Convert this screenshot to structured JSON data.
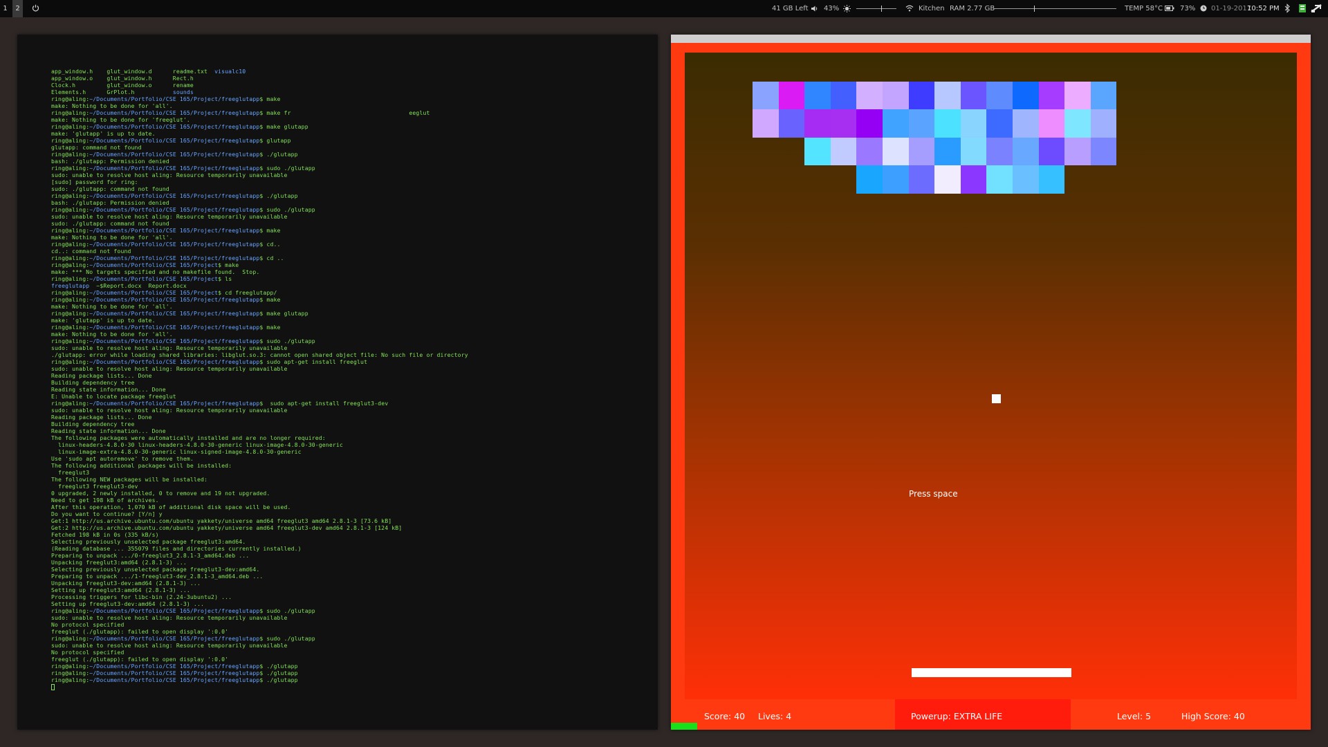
{
  "topbar": {
    "workspaces": [
      "1",
      "2"
    ],
    "active_workspace": "2",
    "disk": "41 GB Left",
    "volume": "43%",
    "volume_level": 0.43,
    "brightness_level": 0.62,
    "wifi": "Kitchen",
    "ram": "RAM 2.77 GB",
    "ram_level": 0.33,
    "temp": "TEMP 58°C",
    "battery": "73%",
    "date": "01-19-2017",
    "time": "10:52 PM"
  },
  "terminal": {
    "lines": [
      {
        "c": "app_window.h    glut_window.d      readme.txt  ",
        "b": "visualc10"
      },
      {
        "c": "app_window.o    glut_window.h      Rect.h"
      },
      {
        "c": "Clock.h         glut_window.o      rename"
      },
      {
        "c": "Elements.h      GrPlot.h           ",
        "b": "sounds"
      },
      {
        "p": "ring@aling:",
        "path": "~/Documents/Portfolio/CSE 165/Project/freeglutapp",
        "c": "$ make"
      },
      {
        "c": "make: Nothing to be done for 'all'."
      },
      {
        "p": "ring@aling:",
        "path": "~/Documents/Portfolio/CSE 165/Project/freeglutapp",
        "c": "$ make fr                                  eeglut"
      },
      {
        "c": "make: Nothing to be done for 'freeglut'."
      },
      {
        "p": "ring@aling:",
        "path": "~/Documents/Portfolio/CSE 165/Project/freeglutapp",
        "c": "$ make glutapp"
      },
      {
        "c": "make: 'glutapp' is up to date."
      },
      {
        "p": "ring@aling:",
        "path": "~/Documents/Portfolio/CSE 165/Project/freeglutapp",
        "c": "$ glutapp"
      },
      {
        "c": "glutapp: command not found"
      },
      {
        "p": "ring@aling:",
        "path": "~/Documents/Portfolio/CSE 165/Project/freeglutapp",
        "c": "$ ./glutapp"
      },
      {
        "c": "bash: ./glutapp: Permission denied"
      },
      {
        "p": "ring@aling:",
        "path": "~/Documents/Portfolio/CSE 165/Project/freeglutapp",
        "c": "$ sudo ./glutapp"
      },
      {
        "c": "sudo: unable to resolve host aling: Resource temporarily unavailable"
      },
      {
        "c": "[sudo] password for ring:"
      },
      {
        "c": "sudo: ./glutapp: command not found"
      },
      {
        "p": "ring@aling:",
        "path": "~/Documents/Portfolio/CSE 165/Project/freeglutapp",
        "c": "$ ./glutapp"
      },
      {
        "c": "bash: ./glutapp: Permission denied"
      },
      {
        "p": "ring@aling:",
        "path": "~/Documents/Portfolio/CSE 165/Project/freeglutapp",
        "c": "$ sudo ./glutapp"
      },
      {
        "c": "sudo: unable to resolve host aling: Resource temporarily unavailable"
      },
      {
        "c": "sudo: ./glutapp: command not found"
      },
      {
        "p": "ring@aling:",
        "path": "~/Documents/Portfolio/CSE 165/Project/freeglutapp",
        "c": "$ make"
      },
      {
        "c": "make: Nothing to be done for 'all'."
      },
      {
        "p": "ring@aling:",
        "path": "~/Documents/Portfolio/CSE 165/Project/freeglutapp",
        "c": "$ cd.."
      },
      {
        "c": "cd..: command not found"
      },
      {
        "p": "ring@aling:",
        "path": "~/Documents/Portfolio/CSE 165/Project/freeglutapp",
        "c": "$ cd .."
      },
      {
        "p": "ring@aling:",
        "path": "~/Documents/Portfolio/CSE 165/Project",
        "c": "$ make"
      },
      {
        "c": "make: *** No targets specified and no makefile found.  Stop."
      },
      {
        "p": "ring@aling:",
        "path": "~/Documents/Portfolio/CSE 165/Project",
        "c": "$ ls"
      },
      {
        "b": "freeglutapp",
        "c": "  ~$Report.docx  Report.docx"
      },
      {
        "p": "ring@aling:",
        "path": "~/Documents/Portfolio/CSE 165/Project",
        "c": "$ cd freeglutapp/"
      },
      {
        "p": "ring@aling:",
        "path": "~/Documents/Portfolio/CSE 165/Project/freeglutapp",
        "c": "$ make"
      },
      {
        "c": "make: Nothing to be done for 'all'."
      },
      {
        "p": "ring@aling:",
        "path": "~/Documents/Portfolio/CSE 165/Project/freeglutapp",
        "c": "$ make glutapp"
      },
      {
        "c": "make: 'glutapp' is up to date."
      },
      {
        "p": "ring@aling:",
        "path": "~/Documents/Portfolio/CSE 165/Project/freeglutapp",
        "c": "$ make"
      },
      {
        "c": "make: Nothing to be done for 'all'."
      },
      {
        "p": "ring@aling:",
        "path": "~/Documents/Portfolio/CSE 165/Project/freeglutapp",
        "c": "$ sudo ./glutapp"
      },
      {
        "c": "sudo: unable to resolve host aling: Resource temporarily unavailable"
      },
      {
        "c": "./glutapp: error while loading shared libraries: libglut.so.3: cannot open shared object file: No such file or directory"
      },
      {
        "p": "ring@aling:",
        "path": "~/Documents/Portfolio/CSE 165/Project/freeglutapp",
        "c": "$ sudo apt-get install freeglut"
      },
      {
        "c": "sudo: unable to resolve host aling: Resource temporarily unavailable"
      },
      {
        "c": "Reading package lists... Done"
      },
      {
        "c": "Building dependency tree"
      },
      {
        "c": "Reading state information... Done"
      },
      {
        "c": "E: Unable to locate package freeglut"
      },
      {
        "p": "ring@aling:",
        "path": "~/Documents/Portfolio/CSE 165/Project/freeglutapp",
        "c": "$  sudo apt-get install freeglut3-dev"
      },
      {
        "c": "sudo: unable to resolve host aling: Resource temporarily unavailable"
      },
      {
        "c": "Reading package lists... Done"
      },
      {
        "c": "Building dependency tree"
      },
      {
        "c": "Reading state information... Done"
      },
      {
        "c": "The following packages were automatically installed and are no longer required:"
      },
      {
        "c": "  linux-headers-4.8.0-30 linux-headers-4.8.0-30-generic linux-image-4.8.0-30-generic"
      },
      {
        "c": "  linux-image-extra-4.8.0-30-generic linux-signed-image-4.8.0-30-generic"
      },
      {
        "c": "Use 'sudo apt autoremove' to remove them."
      },
      {
        "c": "The following additional packages will be installed:"
      },
      {
        "c": "  freeglut3"
      },
      {
        "c": "The following NEW packages will be installed:"
      },
      {
        "c": "  freeglut3 freeglut3-dev"
      },
      {
        "c": "0 upgraded, 2 newly installed, 0 to remove and 19 not upgraded."
      },
      {
        "c": "Need to get 198 kB of archives."
      },
      {
        "c": "After this operation, 1,070 kB of additional disk space will be used."
      },
      {
        "c": "Do you want to continue? [Y/n] y"
      },
      {
        "c": "Get:1 http://us.archive.ubuntu.com/ubuntu yakkety/universe amd64 freeglut3 amd64 2.8.1-3 [73.6 kB]"
      },
      {
        "c": "Get:2 http://us.archive.ubuntu.com/ubuntu yakkety/universe amd64 freeglut3-dev amd64 2.8.1-3 [124 kB]"
      },
      {
        "c": "Fetched 198 kB in 0s (335 kB/s)"
      },
      {
        "c": "Selecting previously unselected package freeglut3:amd64."
      },
      {
        "c": "(Reading database ... 355079 files and directories currently installed.)"
      },
      {
        "c": "Preparing to unpack .../0-freeglut3_2.8.1-3_amd64.deb ..."
      },
      {
        "c": "Unpacking freeglut3:amd64 (2.8.1-3) ..."
      },
      {
        "c": "Selecting previously unselected package freeglut3-dev:amd64."
      },
      {
        "c": "Preparing to unpack .../1-freeglut3-dev_2.8.1-3_amd64.deb ..."
      },
      {
        "c": "Unpacking freeglut3-dev:amd64 (2.8.1-3) ..."
      },
      {
        "c": "Setting up freeglut3:amd64 (2.8.1-3) ..."
      },
      {
        "c": "Processing triggers for libc-bin (2.24-3ubuntu2) ..."
      },
      {
        "c": "Setting up freeglut3-dev:amd64 (2.8.1-3) ..."
      },
      {
        "p": "ring@aling:",
        "path": "~/Documents/Portfolio/CSE 165/Project/freeglutapp",
        "c": "$ sudo ./glutapp"
      },
      {
        "c": "sudo: unable to resolve host aling: Resource temporarily unavailable"
      },
      {
        "c": "No protocol specified"
      },
      {
        "c": "freeglut (./glutapp): failed to open display ':0.0'"
      },
      {
        "p": "ring@aling:",
        "path": "~/Documents/Portfolio/CSE 165/Project/freeglutapp",
        "c": "$ sudo ./glutapp"
      },
      {
        "c": "sudo: unable to resolve host aling: Resource temporarily unavailable"
      },
      {
        "c": "No protocol specified"
      },
      {
        "c": "freeglut (./glutapp): failed to open display ':0.0'"
      },
      {
        "p": "ring@aling:",
        "path": "~/Documents/Portfolio/CSE 165/Project/freeglutapp",
        "c": "$ ./glutapp"
      },
      {
        "p": "ring@aling:",
        "path": "~/Documents/Portfolio/CSE 165/Project/freeglutapp",
        "c": "$ ./glutapp"
      },
      {
        "p": "ring@aling:",
        "path": "~/Documents/Portfolio/CSE 165/Project/freeglutapp",
        "c": "$ ./glutapp"
      },
      {
        "cursor": true
      }
    ]
  },
  "game": {
    "brick_rows": [
      [
        "#8aa3ff",
        "#db1bf3",
        "#2f86ff",
        "#4360ff",
        "#d2b0ff",
        "#c3a5ff",
        "#3d3cff",
        "#b7c7ff",
        "#6a55ff",
        "#5e8cff",
        "#0e6aff",
        "#a63cff",
        "#ecacff",
        "#5aa6ff"
      ],
      [
        "#d1a8ff",
        "#6a62ff",
        "#a62bf3",
        "#a72ff1",
        "#9500f5",
        "#3fa3ff",
        "#5aa3ff",
        "#4ce2ff",
        "#89d4ff",
        "#3d6bff",
        "#9fb6ff",
        "#ed8dff",
        "#7fe6ff",
        "#9fb0ff"
      ],
      [
        null,
        null,
        "#53e4ff",
        "#c2cbff",
        "#9a78ff",
        "#dde2ff",
        "#a59eff",
        "#2a9bff",
        "#82dbff",
        "#7a82ff",
        "#69a8ff",
        "#6d4bff",
        "#b79eff",
        "#7b86ff"
      ],
      [
        null,
        null,
        null,
        null,
        "#18a6ff",
        "#3d9fff",
        "#6c6dff",
        "#f2ecff",
        "#8c37ff",
        "#72e1ff",
        "#6abfff",
        "#37c0ff",
        null,
        null
      ]
    ],
    "press_text": "Press space",
    "score": "Score: 40",
    "lives": "Lives: 4",
    "powerup": "Powerup: EXTRA LIFE",
    "level": "Level: 5",
    "high_score": "High Score: 40"
  }
}
